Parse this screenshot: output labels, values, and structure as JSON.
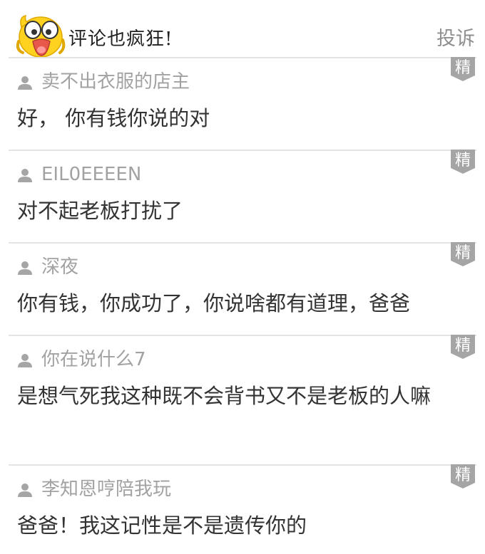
{
  "header": {
    "title": "评论也疯狂!",
    "report_label": "投诉"
  },
  "badge_label": "精",
  "comments": [
    {
      "author": "卖不出衣服的店主",
      "text": "好， 你有钱你说的对"
    },
    {
      "author": "EIL0EEEEN",
      "text": "对不起老板打扰了"
    },
    {
      "author": "深夜",
      "text": "你有钱，你成功了，你说啥都有道理，爸爸"
    },
    {
      "author": "你在说什么7",
      "text": "是想气死我这种既不会背书又不是老板的人嘛"
    },
    {
      "author": "李知恩哼陪我玩",
      "text": "爸爸！我这记性是不是遗传你的"
    }
  ],
  "colors": {
    "badge": "#a5a5a5",
    "divider": "#e3e3e3",
    "author": "#a2a2a2",
    "mascot": "#ffd21f"
  }
}
